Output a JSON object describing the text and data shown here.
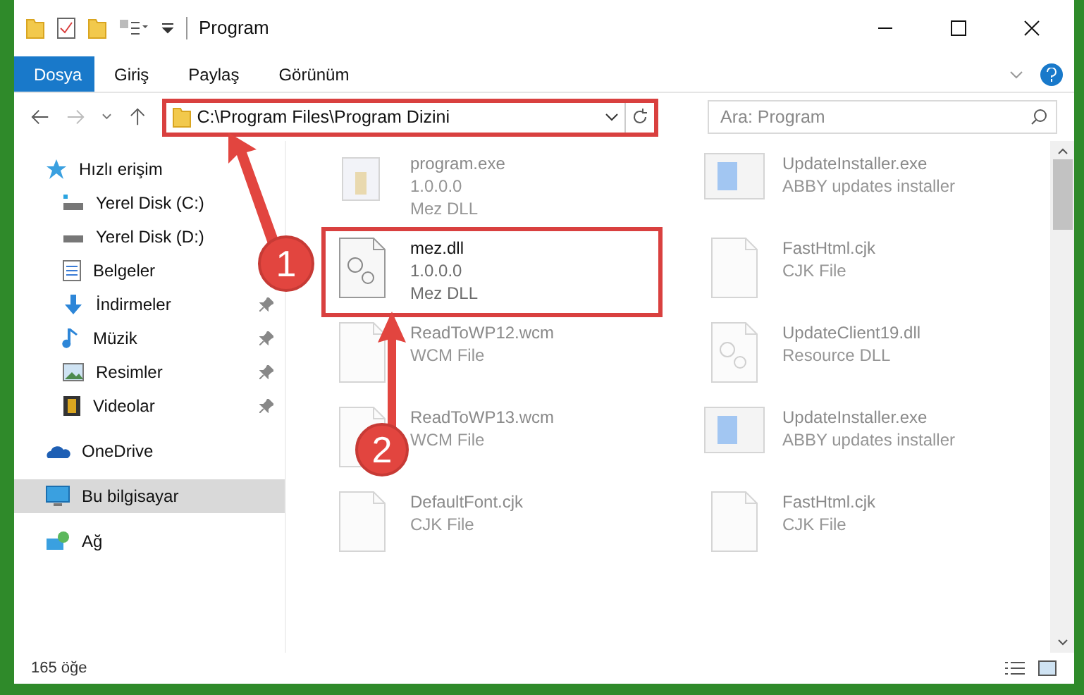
{
  "window": {
    "title": "Program"
  },
  "ribbon": {
    "tabs": [
      {
        "label": "Dosya",
        "selected": true
      },
      {
        "label": "Giriş",
        "selected": false
      },
      {
        "label": "Paylaş",
        "selected": false
      },
      {
        "label": "Görünüm",
        "selected": false
      }
    ]
  },
  "address": {
    "path": "C:\\Program Files\\Program Dizini"
  },
  "search": {
    "placeholder": "Ara: Program"
  },
  "sidebar": {
    "items": [
      {
        "label": "Hızlı erişim",
        "kind": "star",
        "selected": false,
        "children": [
          {
            "label": "Yerel Disk (C:)",
            "kind": "diskc",
            "pinned": false,
            "selected": false
          },
          {
            "label": "Yerel Disk (D:)",
            "kind": "disk",
            "pinned": false,
            "selected": false
          },
          {
            "label": "Belgeler",
            "kind": "doc",
            "pinned": false,
            "selected": false
          },
          {
            "label": "İndirmeler",
            "kind": "download",
            "pinned": true,
            "selected": false
          },
          {
            "label": "Müzik",
            "kind": "music",
            "pinned": true,
            "selected": false
          },
          {
            "label": "Resimler",
            "kind": "pictures",
            "pinned": true,
            "selected": false
          },
          {
            "label": "Videolar",
            "kind": "video",
            "pinned": true,
            "selected": false
          }
        ]
      },
      {
        "label": "OneDrive",
        "kind": "cloud",
        "selected": false
      },
      {
        "label": "Bu bilgisayar",
        "kind": "pc",
        "selected": true
      },
      {
        "label": "Ağ",
        "kind": "network",
        "selected": false
      }
    ]
  },
  "files": [
    {
      "name": "program.exe",
      "lines": [
        "1.0.0.0",
        "Mez DLL"
      ],
      "kind": "exe",
      "blurred": true,
      "highlighted": false
    },
    {
      "name": "UpdateInstaller.exe",
      "lines": [
        "ABBY updates installer"
      ],
      "kind": "installer",
      "blurred": true,
      "highlighted": false
    },
    {
      "name": "mez.dll",
      "lines": [
        "1.0.0.0",
        "Mez DLL"
      ],
      "kind": "dll",
      "blurred": false,
      "highlighted": true
    },
    {
      "name": "FastHtml.cjk",
      "lines": [
        "CJK File"
      ],
      "kind": "file",
      "blurred": true,
      "highlighted": false
    },
    {
      "name": "ReadToWP12.wcm",
      "lines": [
        "WCM File"
      ],
      "kind": "file",
      "blurred": true,
      "highlighted": false
    },
    {
      "name": "UpdateClient19.dll",
      "lines": [
        "Resource DLL"
      ],
      "kind": "dll",
      "blurred": true,
      "highlighted": false
    },
    {
      "name": "ReadToWP13.wcm",
      "lines": [
        "WCM File"
      ],
      "kind": "file",
      "blurred": true,
      "highlighted": false
    },
    {
      "name": "UpdateInstaller.exe",
      "lines": [
        "ABBY updates installer"
      ],
      "kind": "installer",
      "blurred": true,
      "highlighted": false
    },
    {
      "name": "DefaultFont.cjk",
      "lines": [
        "CJK File"
      ],
      "kind": "file",
      "blurred": true,
      "highlighted": false
    },
    {
      "name": "FastHtml.cjk",
      "lines": [
        "CJK File"
      ],
      "kind": "file",
      "blurred": true,
      "highlighted": false
    }
  ],
  "status_bar": {
    "count": "165 öğe"
  },
  "callouts": [
    "1",
    "2"
  ]
}
